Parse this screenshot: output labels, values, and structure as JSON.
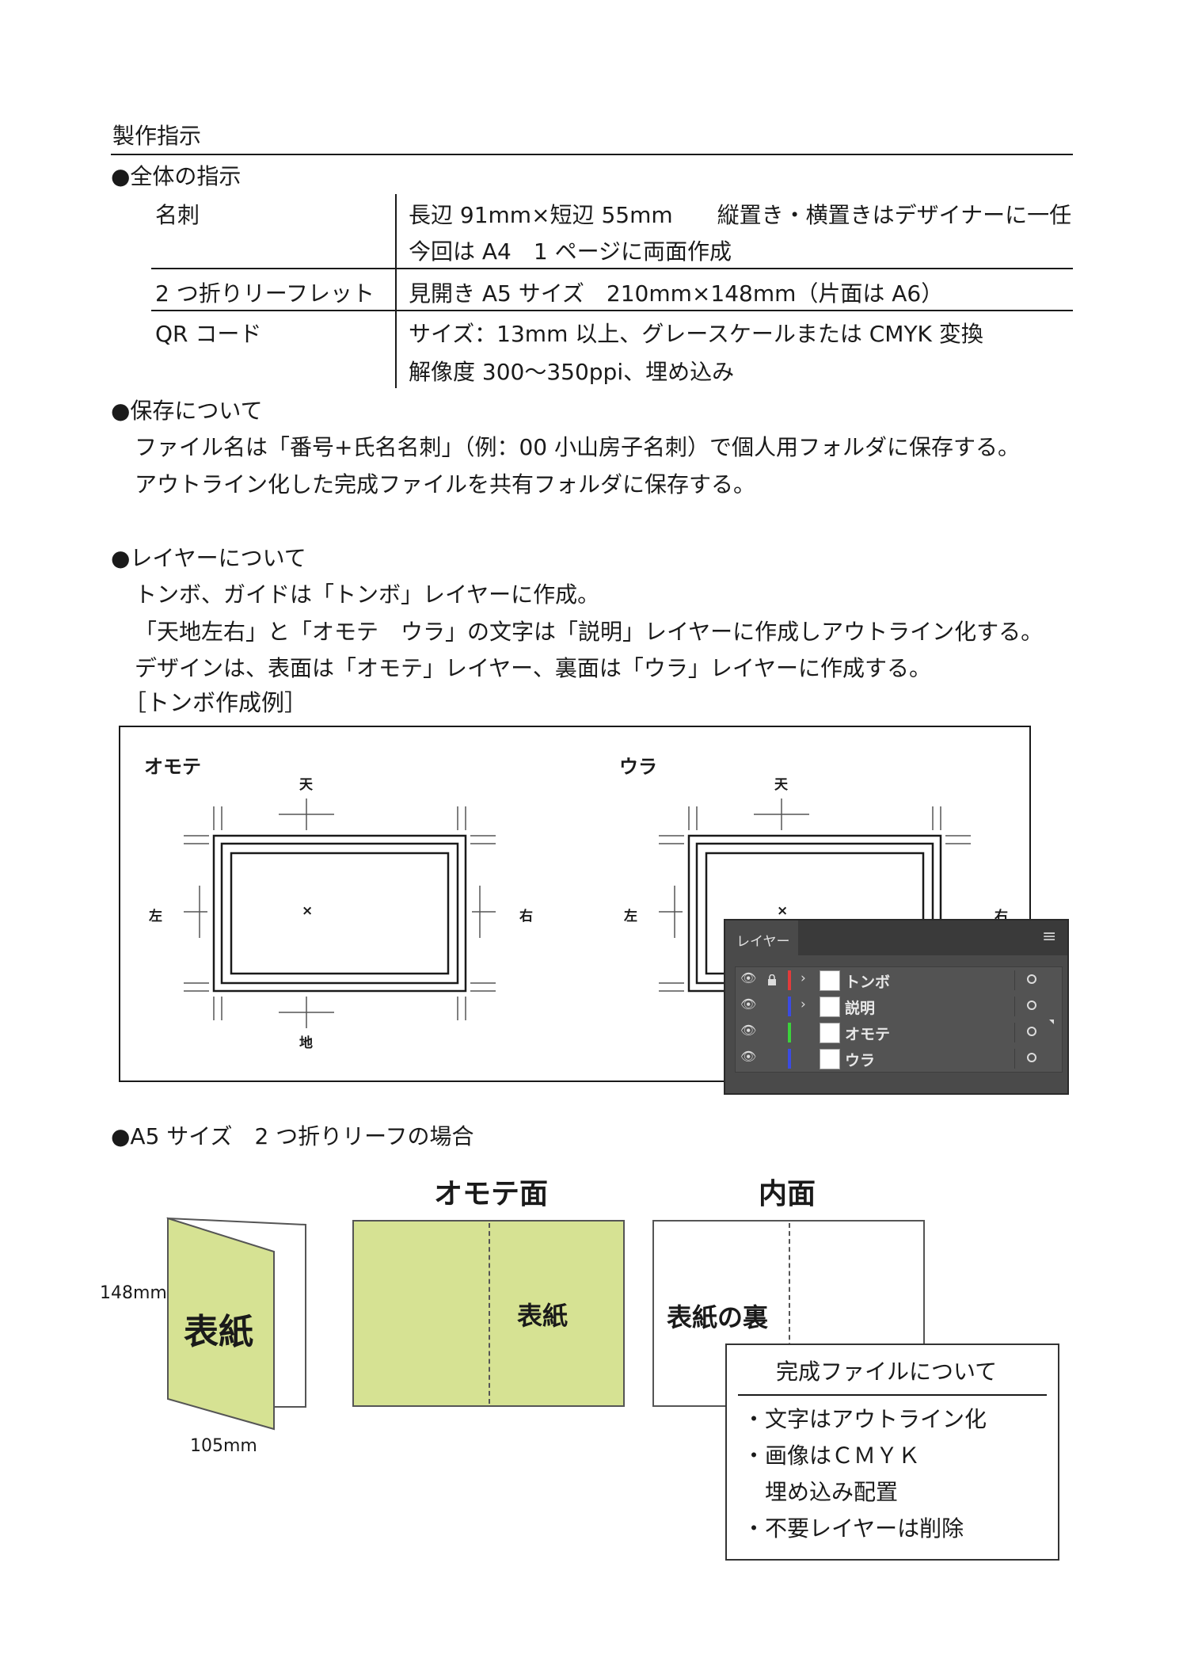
{
  "title": "製作指示",
  "section_all": {
    "heading": "●全体の指示",
    "rows": [
      {
        "label": "名刺",
        "lines": [
          "長辺 91mm×短辺 55mm　　縦置き・横置きはデザイナーに一任",
          "今回は A4　1 ページに両面作成"
        ]
      },
      {
        "label": "2 つ折りリーフレット",
        "lines": [
          "見開き A5 サイズ　210mm×148mm（片面は A6）"
        ]
      },
      {
        "label": "QR コード",
        "lines": [
          "サイズ：13mm 以上、グレースケールまたは CMYK 変換",
          "解像度 300〜350ppi、埋め込み"
        ]
      }
    ]
  },
  "section_save": {
    "heading": "●保存について",
    "lines": [
      "ファイル名は「番号+氏名名刺」（例：00 小山房子名刺）で個人用フォルダに保存する。",
      "アウトライン化した完成ファイルを共有フォルダに保存する。"
    ]
  },
  "section_layer": {
    "heading": "●レイヤーについて",
    "lines": [
      "トンボ、ガイドは「トンボ」レイヤーに作成。",
      "「天地左右」と「オモテ　ウラ」の文字は「説明」レイヤーに作成しアウトライン化する。",
      "デザインは、表面は「オモテ」レイヤー、裏面は「ウラ」レイヤーに作成する。"
    ],
    "example_label": "［トンボ作成例］"
  },
  "tombo": {
    "front": {
      "title": "オモテ",
      "top": "天",
      "bottom": "地",
      "left": "左",
      "right": "右",
      "center": "×"
    },
    "back": {
      "title": "ウラ",
      "top": "天",
      "left": "左",
      "right": "右",
      "center": "×"
    }
  },
  "layers_panel": {
    "title": "レイヤー",
    "menu_icon": "≡",
    "layers": [
      {
        "name": "トンボ",
        "color": "#e23b3b",
        "locked": true,
        "expandable": true
      },
      {
        "name": "説明",
        "color": "#3b4be2",
        "locked": false,
        "expandable": true
      },
      {
        "name": "オモテ",
        "color": "#3bd23b",
        "locked": false,
        "expandable": false
      },
      {
        "name": "ウラ",
        "color": "#3b4be2",
        "locked": false,
        "expandable": false
      }
    ]
  },
  "section_a5": {
    "heading": "●A5 サイズ　2 つ折りリーフの場合",
    "height_label": "148mm",
    "width_label": "105mm",
    "cover_label": "表紙",
    "front_title": "オモテ面",
    "front_cover_label": "表紙",
    "inner_title": "内面",
    "inner_label": "表紙の裏",
    "cover_color": "#d6e293"
  },
  "finish_box": {
    "title": "完成ファイルについて",
    "items": [
      "・文字はアウトライン化",
      "・画像はＣＭＹＫ",
      "　埋め込み配置",
      "・不要レイヤーは削除"
    ]
  }
}
